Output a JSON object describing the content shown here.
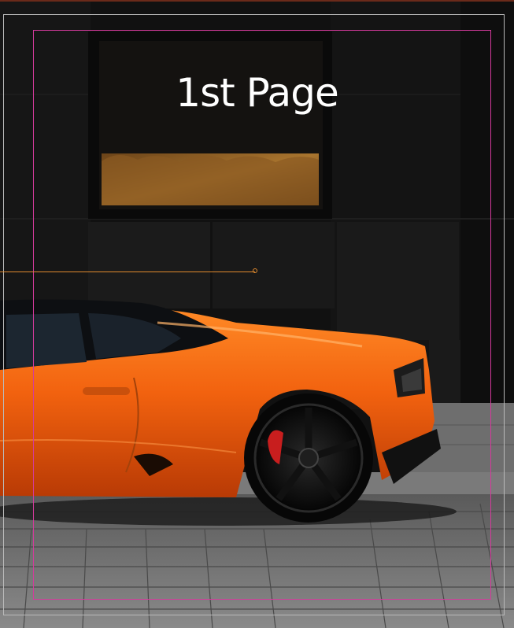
{
  "page": {
    "title": "1st Page"
  },
  "colors": {
    "background": "#0b0b0b",
    "car_orange": "#f26a12",
    "guide_magenta": "#d43a9c",
    "guide_outer": "#b9b9b9",
    "pointer": "#e08a2e"
  },
  "icons": {
    "pointer_end": "circle-handle"
  }
}
